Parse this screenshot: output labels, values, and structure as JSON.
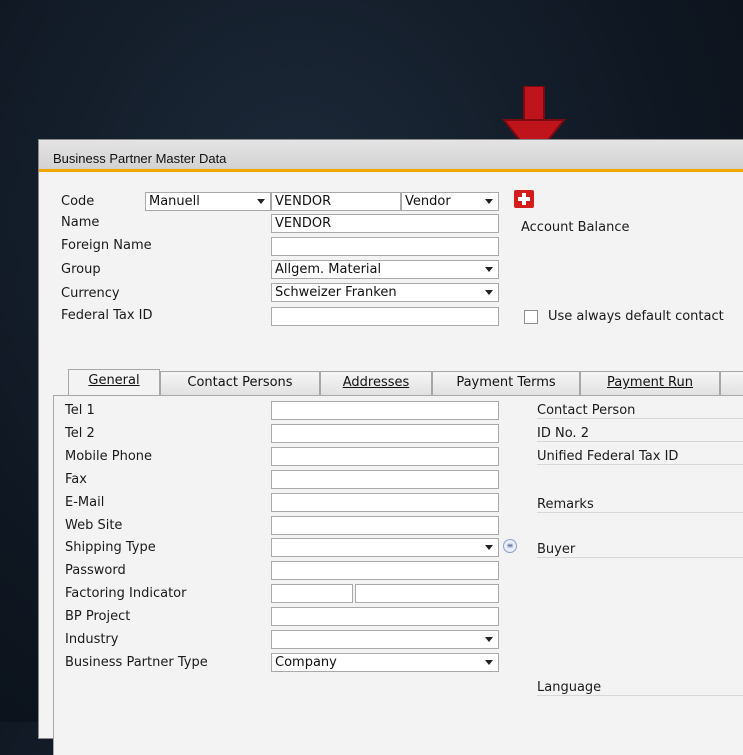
{
  "window": {
    "title": "Business Partner Master Data"
  },
  "header": {
    "code_label": "Code",
    "code_series": "Manuell",
    "code_value": "VENDOR",
    "bp_type": "Vendor",
    "name_label": "Name",
    "name_value": "VENDOR",
    "foreign_name_label": "Foreign Name",
    "foreign_name_value": "",
    "group_label": "Group",
    "group_value": "Allgem. Material",
    "currency_label": "Currency",
    "currency_value": "Schweizer Franken",
    "federal_tax_label": "Federal Tax ID",
    "federal_tax_value": "",
    "account_balance_label": "Account Balance",
    "use_default_contact_label": "Use always default contact"
  },
  "tabs": [
    {
      "label": "General",
      "active": true
    },
    {
      "label": "Contact Persons",
      "active": false
    },
    {
      "label": "Addresses",
      "active": false
    },
    {
      "label": "Payment Terms",
      "active": false
    },
    {
      "label": "Payment Run",
      "active": false
    }
  ],
  "general": {
    "tel1_label": "Tel 1",
    "tel2_label": "Tel 2",
    "mobile_label": "Mobile Phone",
    "fax_label": "Fax",
    "email_label": "E-Mail",
    "website_label": "Web Site",
    "shipping_label": "Shipping Type",
    "password_label": "Password",
    "factoring_label": "Factoring Indicator",
    "bp_project_label": "BP Project",
    "industry_label": "Industry",
    "bp_type_label": "Business Partner Type",
    "bp_type_value": "Company",
    "contact_person_label": "Contact Person",
    "id_no2_label": "ID No. 2",
    "unified_tax_label": "Unified Federal Tax ID",
    "remarks_label": "Remarks",
    "buyer_label": "Buyer",
    "language_label": "Language"
  },
  "colors": {
    "accent": "#f0a800",
    "arrow": "#c0141c",
    "flag": "#d51c1c"
  },
  "icons": [
    "down-arrow-indicator-icon",
    "swiss-flag-icon",
    "link-arrow-icon",
    "chevron-down-icon"
  ]
}
